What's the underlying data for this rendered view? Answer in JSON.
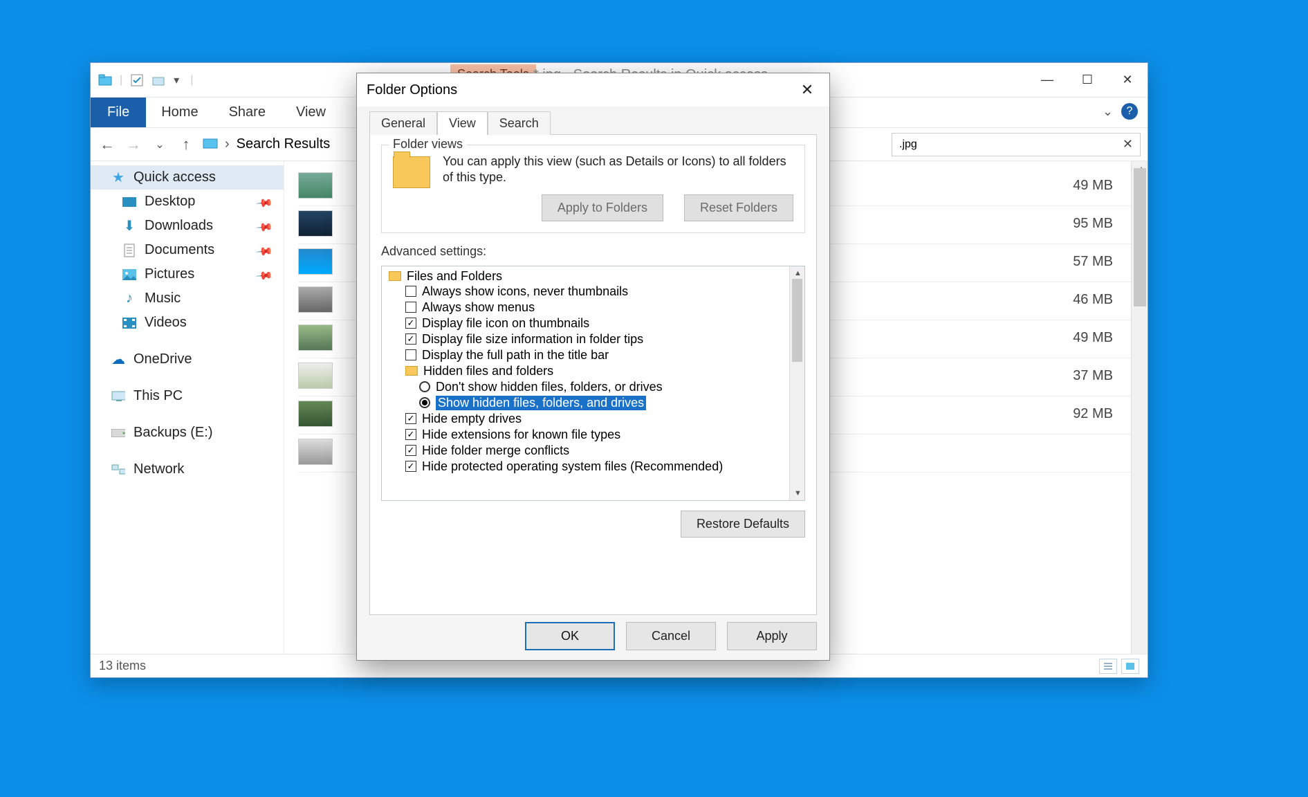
{
  "explorer": {
    "search_tools_label": "Search Tools",
    "window_title": "*.jpg - Search Results in Quick access",
    "ribbon": {
      "file": "File",
      "home": "Home",
      "share": "Share",
      "view": "View"
    },
    "breadcrumb_label": "Search Results",
    "search_value": ".jpg",
    "statusbar_items": "13 items",
    "sidebar": {
      "quick_access": "Quick access",
      "desktop": "Desktop",
      "downloads": "Downloads",
      "documents": "Documents",
      "pictures": "Pictures",
      "music": "Music",
      "videos": "Videos",
      "onedrive": "OneDrive",
      "this_pc": "This PC",
      "backups": "Backups (E:)",
      "network": "Network"
    },
    "files": [
      {
        "size": "49 MB"
      },
      {
        "size": "95 MB"
      },
      {
        "size": "57 MB"
      },
      {
        "size": "46 MB"
      },
      {
        "size": "49 MB"
      },
      {
        "size": "37 MB"
      },
      {
        "size": "92 MB"
      }
    ]
  },
  "dialog": {
    "title": "Folder Options",
    "tabs": {
      "general": "General",
      "view": "View",
      "search": "Search"
    },
    "folder_views": {
      "legend": "Folder views",
      "text": "You can apply this view (such as Details or Icons) to all folders of this type.",
      "apply": "Apply to Folders",
      "reset": "Reset Folders"
    },
    "advanced_label": "Advanced settings:",
    "tree": {
      "root": "Files and Folders",
      "a1": "Always show icons, never thumbnails",
      "a2": "Always show menus",
      "a3": "Display file icon on thumbnails",
      "a4": "Display file size information in folder tips",
      "a5": "Display the full path in the title bar",
      "hidden_group": "Hidden files and folders",
      "r1": "Don't show hidden files, folders, or drives",
      "r2": "Show hidden files, folders, and drives",
      "a6": "Hide empty drives",
      "a7": "Hide extensions for known file types",
      "a8": "Hide folder merge conflicts",
      "a9": "Hide protected operating system files (Recommended)"
    },
    "restore_defaults": "Restore Defaults",
    "ok": "OK",
    "cancel": "Cancel",
    "apply": "Apply"
  }
}
